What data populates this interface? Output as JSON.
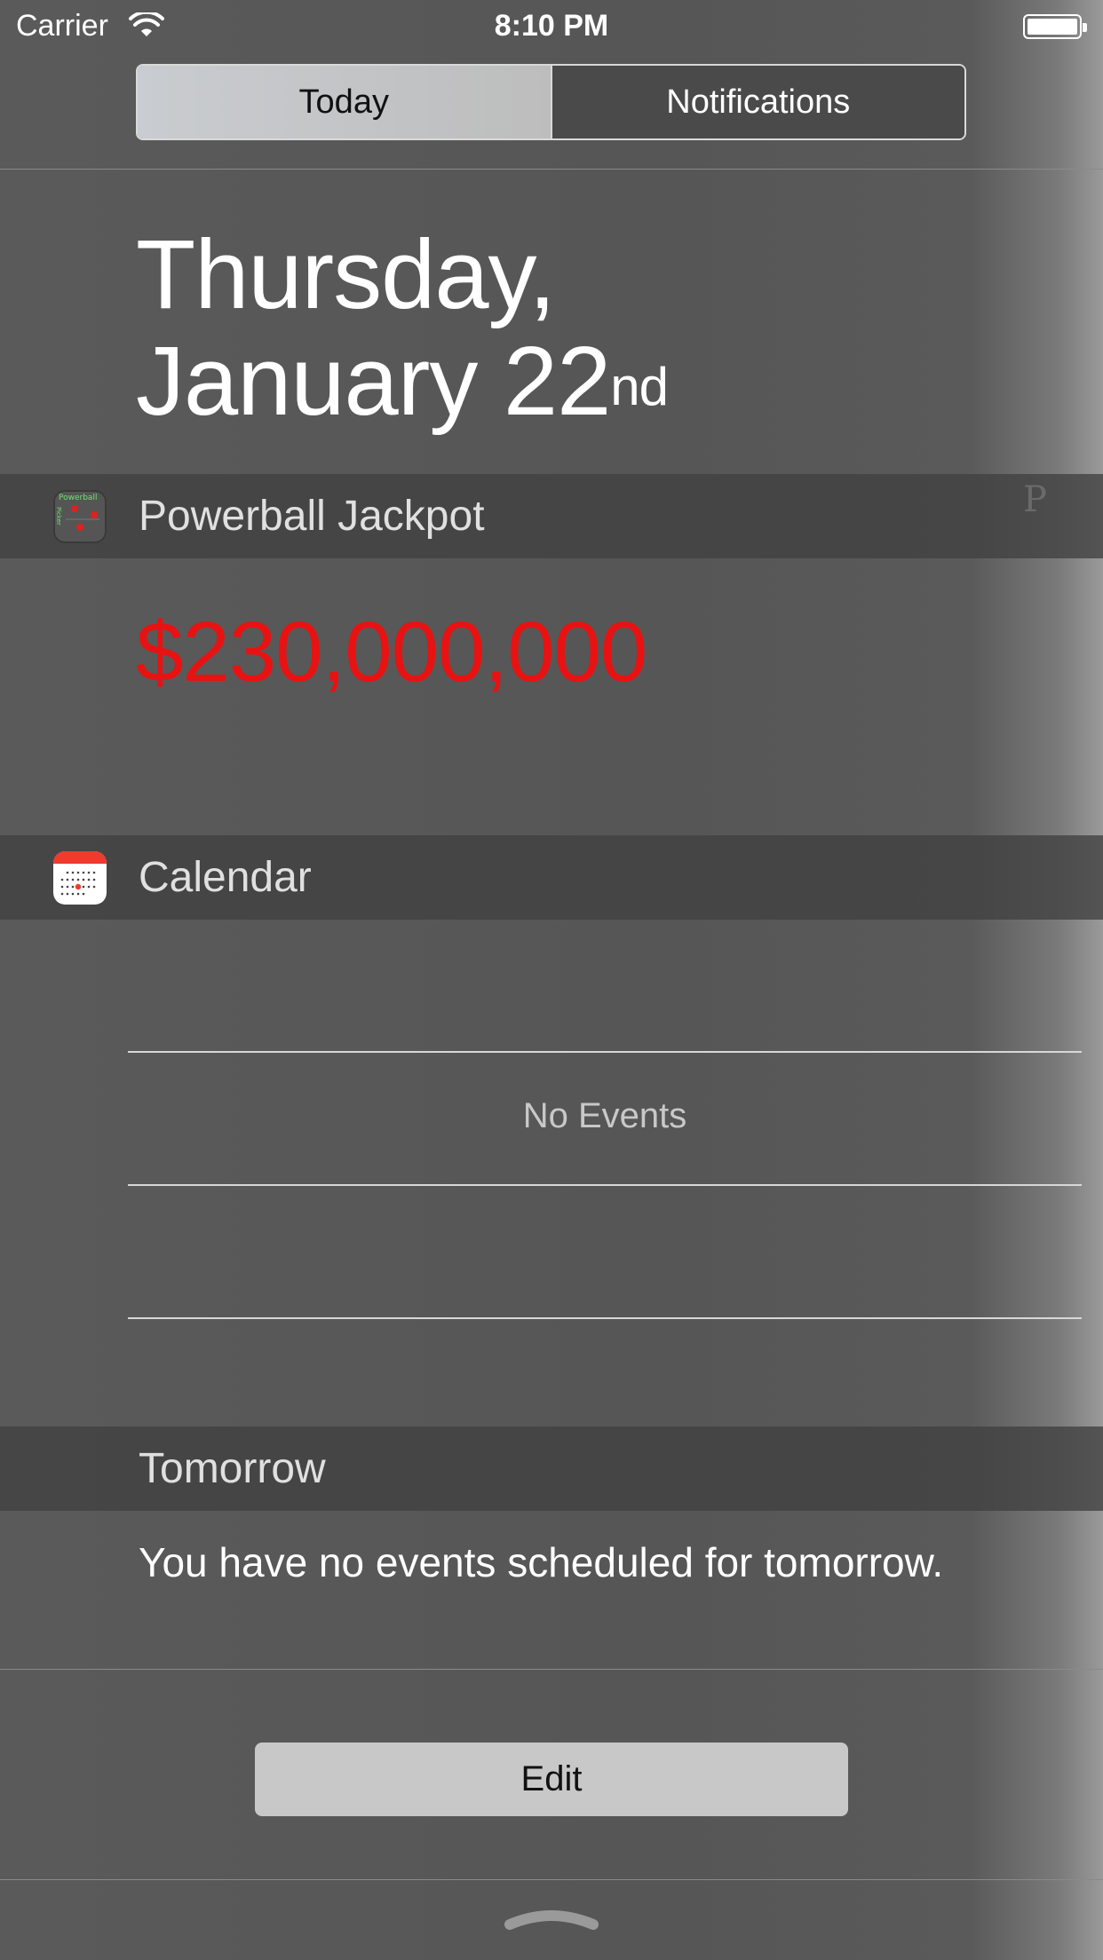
{
  "status_bar": {
    "carrier": "Carrier",
    "time": "8:10 PM",
    "wifi_icon": "wifi-icon",
    "battery_icon": "battery-icon"
  },
  "tabs": [
    {
      "label": "Today",
      "selected": true
    },
    {
      "label": "Notifications",
      "selected": false
    }
  ],
  "date": {
    "weekday": "Thursday,",
    "month_day": "January 22",
    "ordinal": "nd"
  },
  "widgets": {
    "powerball": {
      "title": "Powerball Jackpot",
      "icon": "powerball-picker-icon",
      "icon_text": "Powerball",
      "icon_side_text": "Picker",
      "jackpot": "$230,000,000",
      "jackpot_color": "#e81212",
      "faint_glyph": "P"
    },
    "calendar": {
      "title": "Calendar",
      "icon": "calendar-icon",
      "no_events": "No Events"
    },
    "tomorrow": {
      "title": "Tomorrow",
      "message": "You have no events scheduled for tomorrow."
    }
  },
  "edit_button": {
    "label": "Edit"
  },
  "grabber_icon": "chevron-up-grabber-icon",
  "colors": {
    "background": "#565656",
    "section_header": "#404040",
    "segment_active": "#c4c6c9",
    "edit_button": "#c8c8c8"
  }
}
